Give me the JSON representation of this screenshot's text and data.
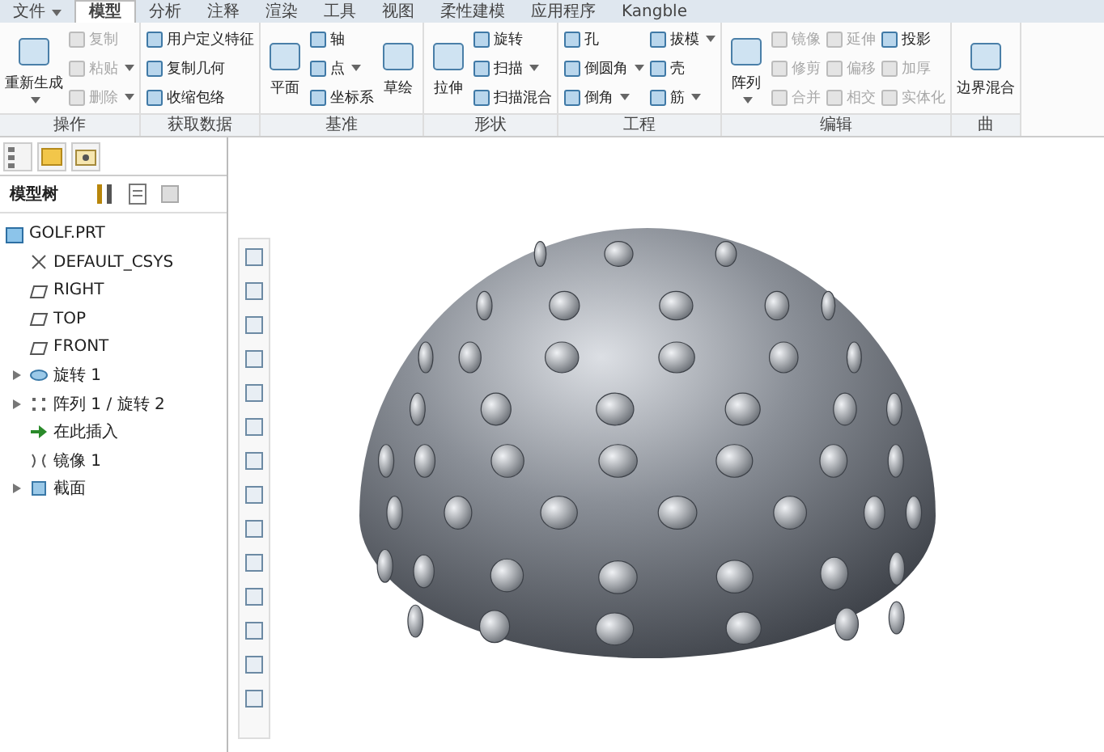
{
  "ribbon_tabs": [
    {
      "label": "文件",
      "selected": false,
      "dropdown": true
    },
    {
      "label": "模型",
      "selected": true,
      "dropdown": false
    },
    {
      "label": "分析",
      "selected": false,
      "dropdown": false
    },
    {
      "label": "注释",
      "selected": false,
      "dropdown": false
    },
    {
      "label": "渲染",
      "selected": false,
      "dropdown": false
    },
    {
      "label": "工具",
      "selected": false,
      "dropdown": false
    },
    {
      "label": "视图",
      "selected": false,
      "dropdown": false
    },
    {
      "label": "柔性建模",
      "selected": false,
      "dropdown": false
    },
    {
      "label": "应用程序",
      "selected": false,
      "dropdown": false
    },
    {
      "label": "Kangble",
      "selected": false,
      "dropdown": false
    }
  ],
  "ribbon_groups": [
    {
      "label": "操作",
      "columns": [
        [
          {
            "label": "重新生成",
            "kind": "big",
            "disabled": false,
            "dropdown": true
          }
        ],
        [
          {
            "label": "复制",
            "kind": "small",
            "disabled": true,
            "dropdown": false
          },
          {
            "label": "粘贴",
            "kind": "small",
            "disabled": true,
            "dropdown": true
          },
          {
            "label": "删除",
            "kind": "small",
            "disabled": true,
            "dropdown": true
          }
        ]
      ]
    },
    {
      "label": "获取数据",
      "columns": [
        [
          {
            "label": "用户定义特征",
            "kind": "small",
            "disabled": false,
            "dropdown": false
          },
          {
            "label": "复制几何",
            "kind": "small",
            "disabled": false,
            "dropdown": false
          },
          {
            "label": "收缩包络",
            "kind": "small",
            "disabled": false,
            "dropdown": false
          }
        ]
      ]
    },
    {
      "label": "基准",
      "columns": [
        [
          {
            "label": "平面",
            "kind": "big",
            "disabled": false,
            "dropdown": false
          }
        ],
        [
          {
            "label": "轴",
            "kind": "small",
            "disabled": false,
            "dropdown": false
          },
          {
            "label": "点",
            "kind": "small",
            "disabled": false,
            "dropdown": true
          },
          {
            "label": "坐标系",
            "kind": "small",
            "disabled": false,
            "dropdown": false
          }
        ],
        [
          {
            "label": "草绘",
            "kind": "big",
            "disabled": false,
            "dropdown": false
          }
        ]
      ]
    },
    {
      "label": "形状",
      "columns": [
        [
          {
            "label": "拉伸",
            "kind": "big",
            "disabled": false,
            "dropdown": false
          }
        ],
        [
          {
            "label": "旋转",
            "kind": "small",
            "disabled": false,
            "dropdown": false
          },
          {
            "label": "扫描",
            "kind": "small",
            "disabled": false,
            "dropdown": true
          },
          {
            "label": "扫描混合",
            "kind": "small",
            "disabled": false,
            "dropdown": false
          }
        ]
      ]
    },
    {
      "label": "工程",
      "columns": [
        [
          {
            "label": "孔",
            "kind": "small",
            "disabled": false,
            "dropdown": false
          },
          {
            "label": "倒圆角",
            "kind": "small",
            "disabled": false,
            "dropdown": true
          },
          {
            "label": "倒角",
            "kind": "small",
            "disabled": false,
            "dropdown": true
          }
        ],
        [
          {
            "label": "拔模",
            "kind": "small",
            "disabled": false,
            "dropdown": true
          },
          {
            "label": "壳",
            "kind": "small",
            "disabled": false,
            "dropdown": false
          },
          {
            "label": "筋",
            "kind": "small",
            "disabled": false,
            "dropdown": true
          }
        ]
      ]
    },
    {
      "label": "编辑",
      "columns": [
        [
          {
            "label": "阵列",
            "kind": "big",
            "disabled": false,
            "dropdown": true
          }
        ],
        [
          {
            "label": "镜像",
            "kind": "small",
            "disabled": true,
            "dropdown": false
          },
          {
            "label": "修剪",
            "kind": "small",
            "disabled": true,
            "dropdown": false
          },
          {
            "label": "合并",
            "kind": "small",
            "disabled": true,
            "dropdown": false
          }
        ],
        [
          {
            "label": "延伸",
            "kind": "small",
            "disabled": true,
            "dropdown": false
          },
          {
            "label": "偏移",
            "kind": "small",
            "disabled": true,
            "dropdown": false
          },
          {
            "label": "相交",
            "kind": "small",
            "disabled": true,
            "dropdown": false
          }
        ],
        [
          {
            "label": "投影",
            "kind": "small",
            "disabled": false,
            "dropdown": false
          },
          {
            "label": "加厚",
            "kind": "small",
            "disabled": true,
            "dropdown": false
          },
          {
            "label": "实体化",
            "kind": "small",
            "disabled": true,
            "dropdown": false
          }
        ]
      ]
    },
    {
      "label": "曲",
      "columns": [
        [
          {
            "label": "边界混合",
            "kind": "big",
            "disabled": false,
            "dropdown": false
          }
        ]
      ]
    }
  ],
  "model_tree": {
    "title": "模型树",
    "items": [
      {
        "label": "GOLF.PRT",
        "kind": "part",
        "children": [
          {
            "label": "DEFAULT_CSYS",
            "kind": "csys",
            "expandable": false
          },
          {
            "label": "RIGHT",
            "kind": "plane",
            "expandable": false
          },
          {
            "label": "TOP",
            "kind": "plane",
            "expandable": false
          },
          {
            "label": "FRONT",
            "kind": "plane",
            "expandable": false
          },
          {
            "label": "旋转 1",
            "kind": "revolve",
            "expandable": true
          },
          {
            "label": "阵列 1 / 旋转 2",
            "kind": "pattern",
            "expandable": true
          },
          {
            "label": "在此插入",
            "kind": "insert",
            "expandable": false
          },
          {
            "label": "镜像 1",
            "kind": "mirror",
            "expandable": false
          },
          {
            "label": "截面",
            "kind": "section",
            "expandable": true
          }
        ]
      }
    ]
  }
}
